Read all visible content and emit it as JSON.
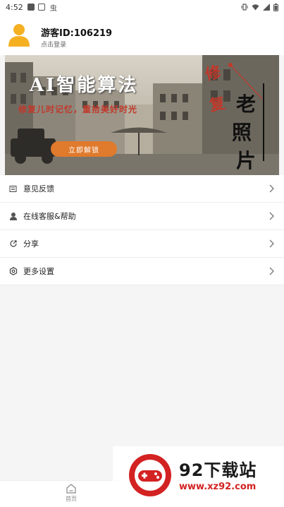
{
  "status_bar": {
    "time": "4:52",
    "extra_text": "虫"
  },
  "profile": {
    "username": "游客ID:106219",
    "login_hint": "点击登录"
  },
  "banner": {
    "title": "AI智能算法",
    "subtitle": "修复儿时记忆，重拾美好时光",
    "button_label": "立即解锁",
    "side_text_1": "修",
    "side_text_2": "复",
    "side_text_3": "老",
    "side_text_4": "照",
    "side_text_5": "片"
  },
  "menu": {
    "items": [
      {
        "label": "意见反馈",
        "icon": "feedback-icon"
      },
      {
        "label": "在线客服&帮助",
        "icon": "support-icon"
      },
      {
        "label": "分享",
        "icon": "share-icon"
      },
      {
        "label": "更多设置",
        "icon": "settings-icon"
      }
    ]
  },
  "bottom_nav": {
    "home_label": "首页"
  },
  "watermark": {
    "name": "92下载站",
    "url": "www.xz92.com"
  },
  "colors": {
    "accent_orange": "#e07a2c",
    "avatar_yellow": "#f5b022",
    "watermark_red": "#d32222"
  }
}
